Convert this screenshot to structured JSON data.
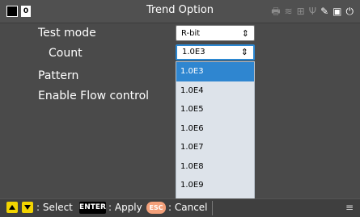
{
  "titlebar": {
    "digit": "0",
    "title": "Trend Option",
    "status_icons": [
      "printer-icon",
      "wifi-icon",
      "network-icon",
      "usb-icon",
      "edit-icon",
      "save-icon",
      "power-icon"
    ]
  },
  "form": {
    "test_mode_label": "Test mode",
    "test_mode_value": "R-bit",
    "count_label": "Count",
    "count_value": "1.0E3",
    "pattern_label": "Pattern",
    "flow_label": "Enable Flow control"
  },
  "dropdown": {
    "options": [
      "1.0E3",
      "1.0E4",
      "1.0E5",
      "1.0E6",
      "1.0E7",
      "1.0E8",
      "1.0E9"
    ],
    "selected_index": 0
  },
  "bottombar": {
    "select_text": ": Select",
    "enter_key": "ENTER",
    "apply_text": ": Apply",
    "esc_key": "ESC",
    "cancel_text": ": Cancel"
  },
  "colors": {
    "accent": "#2f86d0",
    "key_yellow": "#f2d400",
    "esc_orange": "#f3a07a"
  }
}
